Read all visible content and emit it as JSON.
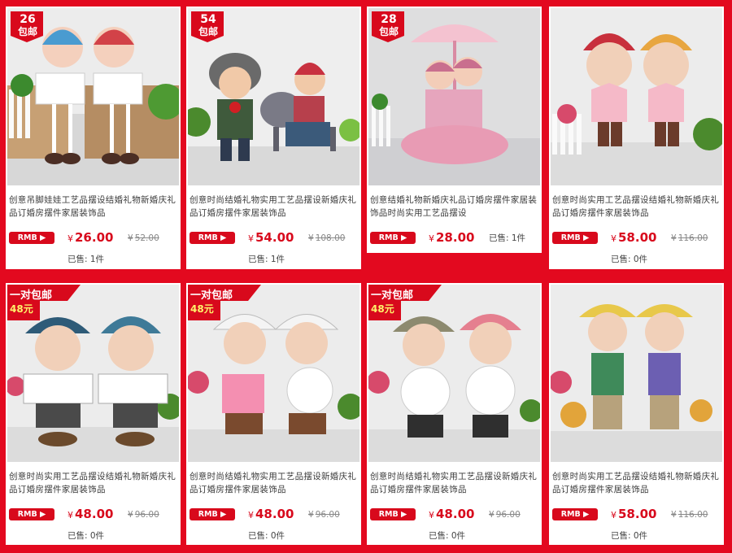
{
  "products": [
    {
      "badge_count": "26",
      "badge_text": "包邮",
      "promo_line1": "",
      "promo_line2": "",
      "title": "创意吊脚娃娃工艺品摆设结婚礼物新婚庆礼品订婚房摆件家居装饰品",
      "rmb_label": "RMB ▶",
      "price": "26.00",
      "old_price": "52.00",
      "sold": "已售: 1件"
    },
    {
      "badge_count": "54",
      "badge_text": "包邮",
      "promo_line1": "",
      "promo_line2": "",
      "title": "创意时尚结婚礼物实用工艺品摆设新婚庆礼品订婚房摆件家居装饰品",
      "rmb_label": "RMB ▶",
      "price": "54.00",
      "old_price": "108.00",
      "sold": "已售: 1件"
    },
    {
      "badge_count": "28",
      "badge_text": "包邮",
      "promo_line1": "",
      "promo_line2": "",
      "title": "创意结婚礼物新婚庆礼品订婚房摆件家居装饰品时尚实用工艺品摆设",
      "rmb_label": "RMB ▶",
      "price": "28.00",
      "old_price": "",
      "sold": "已售: 1件"
    },
    {
      "badge_count": "",
      "badge_text": "",
      "promo_line1": "",
      "promo_line2": "",
      "title": "创意时尚实用工艺品摆设结婚礼物新婚庆礼品订婚房摆件家居装饰品",
      "rmb_label": "RMB ▶",
      "price": "58.00",
      "old_price": "116.00",
      "sold": "已售: 0件"
    },
    {
      "badge_count": "",
      "badge_text": "",
      "promo_line1": "一对包邮",
      "promo_line2": "48元",
      "title": "创意时尚实用工艺品摆设结婚礼物新婚庆礼品订婚房摆件家居装饰品",
      "rmb_label": "RMB ▶",
      "price": "48.00",
      "old_price": "96.00",
      "sold": "已售: 0件"
    },
    {
      "badge_count": "",
      "badge_text": "",
      "promo_line1": "一对包邮",
      "promo_line2": "48元",
      "title": "创意时尚结婚礼物实用工艺品摆设新婚庆礼品订婚房摆件家居装饰品",
      "rmb_label": "RMB ▶",
      "price": "48.00",
      "old_price": "96.00",
      "sold": "已售: 0件"
    },
    {
      "badge_count": "",
      "badge_text": "",
      "promo_line1": "一对包邮",
      "promo_line2": "48元",
      "title": "创意时尚结婚礼物实用工艺品摆设新婚庆礼品订婚房摆件家居装饰品",
      "rmb_label": "RMB ▶",
      "price": "48.00",
      "old_price": "96.00",
      "sold": "已售: 0件"
    },
    {
      "badge_count": "",
      "badge_text": "",
      "promo_line1": "",
      "promo_line2": "",
      "title": "创意时尚实用工艺品摆设结婚礼物新婚庆礼品订婚房摆件家居装饰品",
      "rmb_label": "RMB ▶",
      "price": "58.00",
      "old_price": "116.00",
      "sold": "已售: 0件"
    }
  ],
  "currency_symbol": "¥",
  "colors": {
    "page_background": "#e3091f",
    "accent": "#d8091c",
    "old_price": "#888888"
  },
  "icons": {
    "rmb_arrow": "right-triangle-icon"
  }
}
